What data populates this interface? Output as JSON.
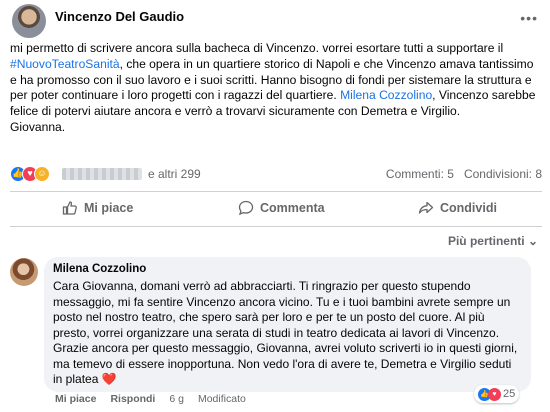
{
  "post": {
    "author": "Vincenzo Del Gaudio",
    "more_label": "•••",
    "text_parts": [
      "mi permetto di scrivere ancora sulla bacheca di Vincenzo. vorrei esortare tutti a supportare il ",
      "#NuovoTeatroSanità",
      ", che opera in un quartiere storico di Napoli e che Vincenzo amava tantissimo e ha promosso con il suo lavoro e i suoi scritti. Hanno bisogno di fondi per sistemare la struttura e per poter continuare i loro progetti con i ragazzi del quartiere. ",
      "Milena Cozzolino",
      ", Vincenzo sarebbe felice di potervi aiutare ancora e verrò a trovarvi sicuramente con Demetra e Virgilio.\nGiovanna."
    ]
  },
  "reactions": {
    "others": "e altri 299",
    "comments": "Commenti: 5",
    "shares": "Condivisioni: 8",
    "icons": [
      "like-icon",
      "love-icon",
      "care-icon"
    ],
    "colors": {
      "like": "#1877f2",
      "love": "#f33e58",
      "care": "#f7b125",
      "link": "#1b74e4"
    }
  },
  "actions": {
    "like": "Mi piace",
    "comment": "Commenta",
    "share": "Condividi"
  },
  "sort_label": "Più pertinenti ⌄",
  "comment": {
    "author": "Milena Cozzolino",
    "text": "Cara Giovanna, domani verrò ad abbracciarti. Ti ringrazio per questo stupendo messaggio, mi fa sentire Vincenzo ancora vicino. Tu e i tuoi bambini avrete sempre un posto nel nostro teatro, che spero sarà per loro e per te un posto del cuore. Al più presto, vorrei organizzare una serata di studi in teatro dedicata ai lavori di Vincenzo. Grazie ancora per questo messaggio, Giovanna, avrei voluto scriverti io in questi giorni, ma temevo di essere inopportuna. Non vedo l'ora di avere te, Demetra e Virgilio seduti in platea ",
    "heart": "❤️",
    "reaction_count": "25",
    "like": "Mi piace",
    "reply": "Rispondi",
    "time": "6 g",
    "edited": "Modificato"
  }
}
